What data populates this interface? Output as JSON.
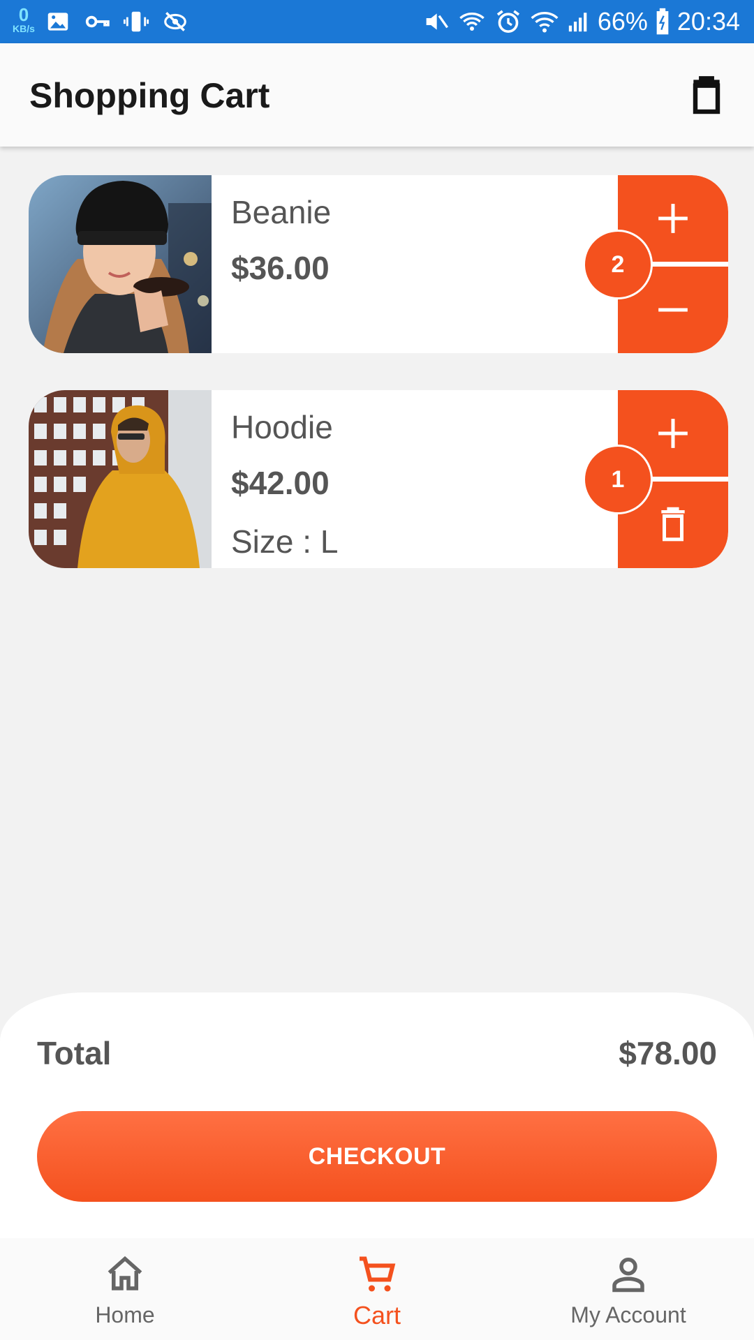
{
  "status_bar": {
    "net_speed_value": "0",
    "net_speed_unit": "KB/s",
    "left_icons": [
      "image-icon",
      "vpn-key-icon",
      "vibrate-icon",
      "eye-off-icon"
    ],
    "right_icons": [
      "mute-icon",
      "wifi-call-icon",
      "alarm-icon",
      "wifi-icon",
      "signal-icon",
      "battery-icon"
    ],
    "battery": "66%",
    "time": "20:34"
  },
  "app_bar": {
    "title": "Shopping Cart",
    "action_icon": "trash-icon"
  },
  "cart": {
    "items": [
      {
        "name": "Beanie",
        "price": "$36.00",
        "size": "",
        "quantity": "2",
        "top_control": "plus-icon",
        "bottom_control": "minus-icon",
        "image": "woman-in-black-beanie-photo"
      },
      {
        "name": "Hoodie",
        "price": "$42.00",
        "size": "Size : L",
        "quantity": "1",
        "top_control": "plus-icon",
        "bottom_control": "trash-icon",
        "image": "man-in-yellow-hoodie-photo"
      }
    ]
  },
  "summary": {
    "total_label": "Total",
    "total_value": "$78.00",
    "checkout_label": "CHECKOUT"
  },
  "bottom_nav": {
    "items": [
      {
        "label": "Home",
        "icon": "home-icon",
        "active": false
      },
      {
        "label": "Cart",
        "icon": "cart-icon",
        "active": true
      },
      {
        "label": "My Account",
        "icon": "account-icon",
        "active": false
      }
    ]
  },
  "colors": {
    "status_bar": "#1b78d6",
    "accent": "#f4511e",
    "background": "#f2f2f2",
    "text_secondary": "#555555"
  }
}
